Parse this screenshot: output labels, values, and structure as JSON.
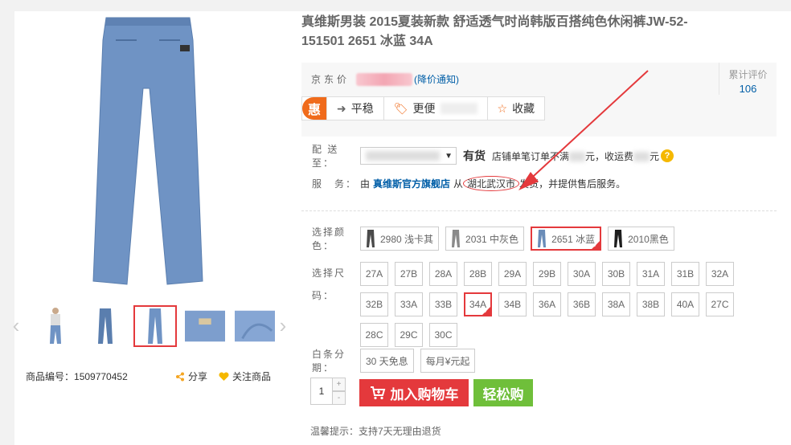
{
  "product": {
    "title": "真维斯男装 2015夏装新款 舒适透气时尚韩版百搭纯色休闲裤JW-52-151501 2651 冰蓝 34A",
    "sku_label": "商品编号：",
    "sku": "1509770452",
    "share": "分享",
    "follow": "关注商品"
  },
  "price": {
    "label": "京东价",
    "notice": "(降价通知)",
    "review_label": "累计评价",
    "review_count": "106"
  },
  "promo": {
    "icon": "惠",
    "items": [
      {
        "icon": "arrow-right-icon",
        "label": "平稳"
      },
      {
        "icon": "tag-icon",
        "label": "更便"
      },
      {
        "icon": "star-icon",
        "label": "收藏"
      }
    ]
  },
  "delivery": {
    "label": "配 送 至：",
    "stock": "有货",
    "ship_text_1": "店铺单笔订单不满",
    "ship_text_2": "元，收运费",
    "ship_text_3": "元"
  },
  "service": {
    "label": "服　务：",
    "prefix": "由",
    "seller": "真维斯官方旗舰店",
    "from": "从",
    "location": "湖北武汉市",
    "suffix": "发货，并提供售后服务。"
  },
  "color": {
    "label": "选择颜色：",
    "options": [
      {
        "label": "2980 浅卡其",
        "color": "#4a4a4a"
      },
      {
        "label": "2031 中灰色",
        "color": "#8a8a8a"
      },
      {
        "label": "2651 冰蓝",
        "color": "#6a8cb8",
        "selected": true
      },
      {
        "label": "2010黑色",
        "color": "#1e1e1e"
      }
    ]
  },
  "size": {
    "label": "选择尺码：",
    "options": [
      "27A",
      "27B",
      "28A",
      "28B",
      "29A",
      "29B",
      "30A",
      "30B",
      "31A",
      "31B",
      "32A",
      "32B",
      "33A",
      "33B",
      "34A",
      "34B",
      "36A",
      "36B",
      "38A",
      "38B",
      "40A",
      "27C",
      "28C",
      "29C",
      "30C"
    ],
    "selected": "34A"
  },
  "installment": {
    "label": "白条分期：",
    "options": [
      "30 天免息",
      "每月¥元起"
    ]
  },
  "purchase": {
    "qty": "1",
    "plus": "+",
    "minus": "-",
    "cart": "加入购物车",
    "easy": "轻松购"
  },
  "tip": "温馨提示：支持7天无理由退货",
  "colors": {
    "accent": "#e4393c",
    "link": "#005ea7",
    "green": "#6fbf3a",
    "promo_orange": "#f06b1b"
  }
}
